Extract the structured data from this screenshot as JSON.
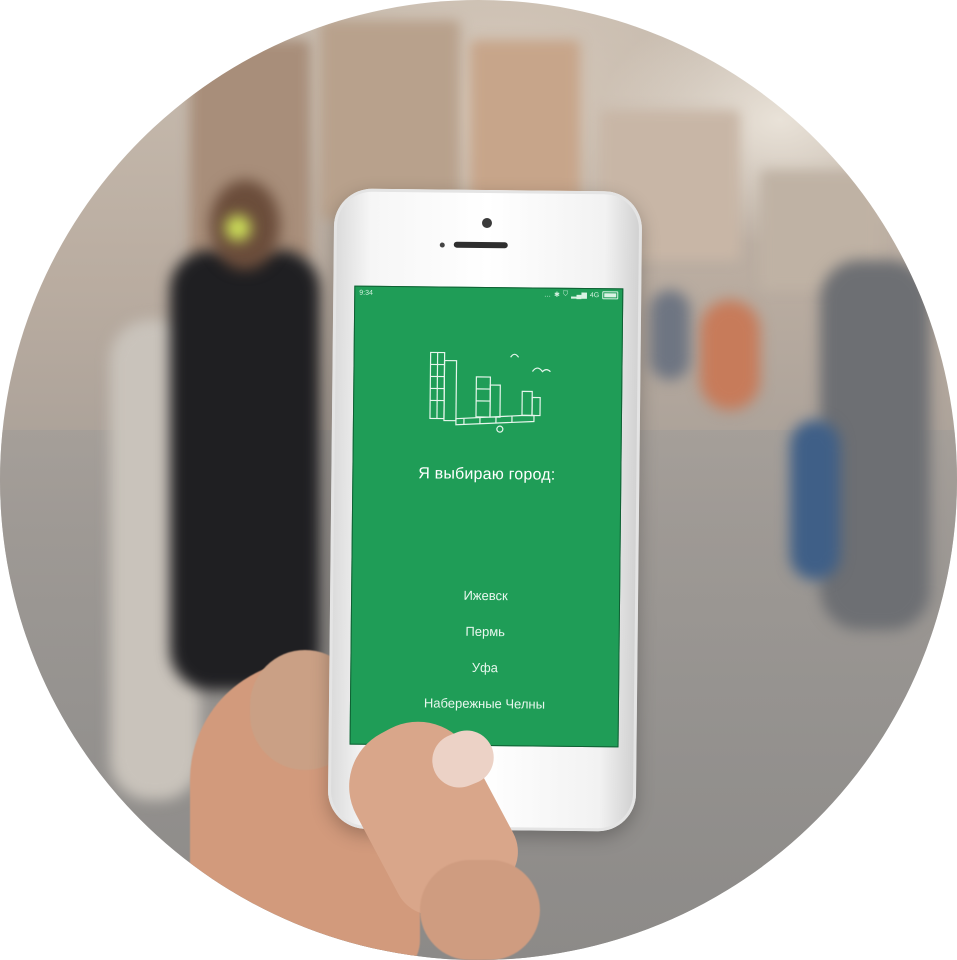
{
  "status_bar": {
    "time": "9:34",
    "icons": [
      "more-dots-icon",
      "bluetooth-icon",
      "shield-icon",
      "signal-icon"
    ],
    "network": "4G"
  },
  "app": {
    "title": "Я выбираю город:",
    "cities": [
      {
        "label": "Ижевск"
      },
      {
        "label": "Пермь"
      },
      {
        "label": "Уфа"
      },
      {
        "label": "Набережные Челны"
      }
    ]
  },
  "colors": {
    "screen_bg": "#1f9d57",
    "text": "#ffffff"
  }
}
